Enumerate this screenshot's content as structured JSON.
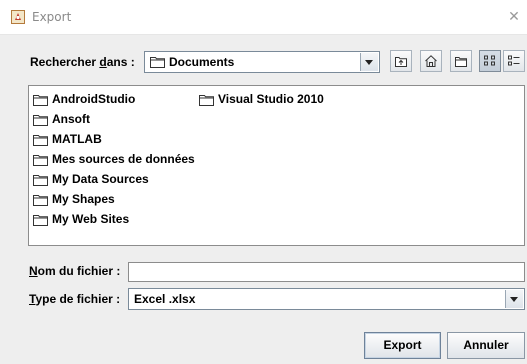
{
  "window": {
    "title": "Export",
    "app_icon": "java-duke-icon",
    "close_glyph": "✕"
  },
  "look_in": {
    "label_prefix": "Rechercher ",
    "label_mnemonic": "d",
    "label_suffix": "ans :",
    "value": "Documents"
  },
  "toolbar": {
    "buttons": [
      "up-one-level-icon",
      "home-icon",
      "new-folder-icon",
      "list-view-icon",
      "details-view-icon"
    ],
    "active": "list-view-icon"
  },
  "files": {
    "items": [
      "AndroidStudio",
      "Ansoft",
      "MATLAB",
      "Mes sources de données",
      "My Data Sources",
      "My Shapes",
      "My Web Sites",
      "Visual Studio 2010"
    ]
  },
  "filename": {
    "label_mnemonic": "N",
    "label_rest": "om du fichier :",
    "value": ""
  },
  "filetype": {
    "label_mnemonic": "T",
    "label_rest": "ype de fichier :",
    "value": "Excel .xlsx"
  },
  "buttons": {
    "export": "Export",
    "cancel": "Annuler"
  },
  "colors": {
    "background": "#eeeeee",
    "titlebar": "#ffffff",
    "field_border": "#8c8c8c"
  }
}
